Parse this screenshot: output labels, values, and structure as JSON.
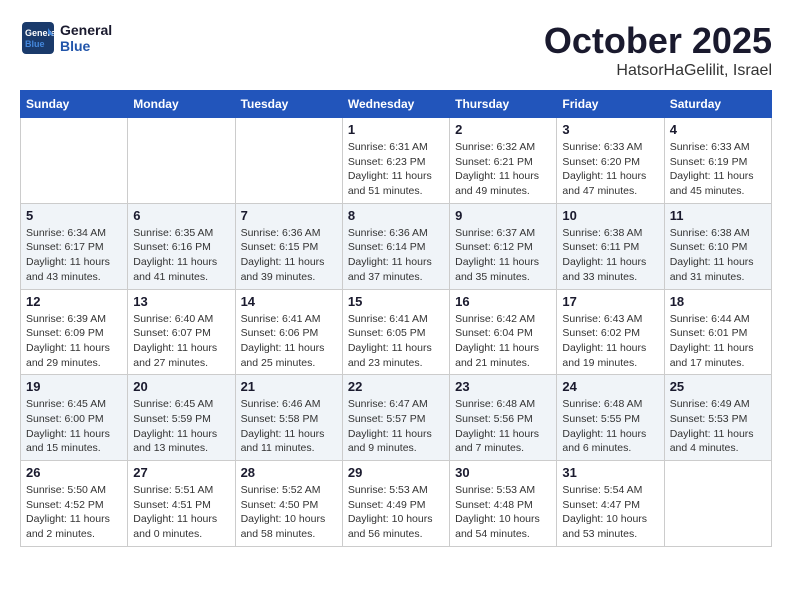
{
  "header": {
    "logo_line1": "General",
    "logo_line2": "Blue",
    "month": "October 2025",
    "location": "HatsorHaGelilit, Israel"
  },
  "days_of_week": [
    "Sunday",
    "Monday",
    "Tuesday",
    "Wednesday",
    "Thursday",
    "Friday",
    "Saturday"
  ],
  "weeks": [
    [
      {
        "day": "",
        "info": ""
      },
      {
        "day": "",
        "info": ""
      },
      {
        "day": "",
        "info": ""
      },
      {
        "day": "1",
        "info": "Sunrise: 6:31 AM\nSunset: 6:23 PM\nDaylight: 11 hours\nand 51 minutes."
      },
      {
        "day": "2",
        "info": "Sunrise: 6:32 AM\nSunset: 6:21 PM\nDaylight: 11 hours\nand 49 minutes."
      },
      {
        "day": "3",
        "info": "Sunrise: 6:33 AM\nSunset: 6:20 PM\nDaylight: 11 hours\nand 47 minutes."
      },
      {
        "day": "4",
        "info": "Sunrise: 6:33 AM\nSunset: 6:19 PM\nDaylight: 11 hours\nand 45 minutes."
      }
    ],
    [
      {
        "day": "5",
        "info": "Sunrise: 6:34 AM\nSunset: 6:17 PM\nDaylight: 11 hours\nand 43 minutes."
      },
      {
        "day": "6",
        "info": "Sunrise: 6:35 AM\nSunset: 6:16 PM\nDaylight: 11 hours\nand 41 minutes."
      },
      {
        "day": "7",
        "info": "Sunrise: 6:36 AM\nSunset: 6:15 PM\nDaylight: 11 hours\nand 39 minutes."
      },
      {
        "day": "8",
        "info": "Sunrise: 6:36 AM\nSunset: 6:14 PM\nDaylight: 11 hours\nand 37 minutes."
      },
      {
        "day": "9",
        "info": "Sunrise: 6:37 AM\nSunset: 6:12 PM\nDaylight: 11 hours\nand 35 minutes."
      },
      {
        "day": "10",
        "info": "Sunrise: 6:38 AM\nSunset: 6:11 PM\nDaylight: 11 hours\nand 33 minutes."
      },
      {
        "day": "11",
        "info": "Sunrise: 6:38 AM\nSunset: 6:10 PM\nDaylight: 11 hours\nand 31 minutes."
      }
    ],
    [
      {
        "day": "12",
        "info": "Sunrise: 6:39 AM\nSunset: 6:09 PM\nDaylight: 11 hours\nand 29 minutes."
      },
      {
        "day": "13",
        "info": "Sunrise: 6:40 AM\nSunset: 6:07 PM\nDaylight: 11 hours\nand 27 minutes."
      },
      {
        "day": "14",
        "info": "Sunrise: 6:41 AM\nSunset: 6:06 PM\nDaylight: 11 hours\nand 25 minutes."
      },
      {
        "day": "15",
        "info": "Sunrise: 6:41 AM\nSunset: 6:05 PM\nDaylight: 11 hours\nand 23 minutes."
      },
      {
        "day": "16",
        "info": "Sunrise: 6:42 AM\nSunset: 6:04 PM\nDaylight: 11 hours\nand 21 minutes."
      },
      {
        "day": "17",
        "info": "Sunrise: 6:43 AM\nSunset: 6:02 PM\nDaylight: 11 hours\nand 19 minutes."
      },
      {
        "day": "18",
        "info": "Sunrise: 6:44 AM\nSunset: 6:01 PM\nDaylight: 11 hours\nand 17 minutes."
      }
    ],
    [
      {
        "day": "19",
        "info": "Sunrise: 6:45 AM\nSunset: 6:00 PM\nDaylight: 11 hours\nand 15 minutes."
      },
      {
        "day": "20",
        "info": "Sunrise: 6:45 AM\nSunset: 5:59 PM\nDaylight: 11 hours\nand 13 minutes."
      },
      {
        "day": "21",
        "info": "Sunrise: 6:46 AM\nSunset: 5:58 PM\nDaylight: 11 hours\nand 11 minutes."
      },
      {
        "day": "22",
        "info": "Sunrise: 6:47 AM\nSunset: 5:57 PM\nDaylight: 11 hours\nand 9 minutes."
      },
      {
        "day": "23",
        "info": "Sunrise: 6:48 AM\nSunset: 5:56 PM\nDaylight: 11 hours\nand 7 minutes."
      },
      {
        "day": "24",
        "info": "Sunrise: 6:48 AM\nSunset: 5:55 PM\nDaylight: 11 hours\nand 6 minutes."
      },
      {
        "day": "25",
        "info": "Sunrise: 6:49 AM\nSunset: 5:53 PM\nDaylight: 11 hours\nand 4 minutes."
      }
    ],
    [
      {
        "day": "26",
        "info": "Sunrise: 5:50 AM\nSunset: 4:52 PM\nDaylight: 11 hours\nand 2 minutes."
      },
      {
        "day": "27",
        "info": "Sunrise: 5:51 AM\nSunset: 4:51 PM\nDaylight: 11 hours\nand 0 minutes."
      },
      {
        "day": "28",
        "info": "Sunrise: 5:52 AM\nSunset: 4:50 PM\nDaylight: 10 hours\nand 58 minutes."
      },
      {
        "day": "29",
        "info": "Sunrise: 5:53 AM\nSunset: 4:49 PM\nDaylight: 10 hours\nand 56 minutes."
      },
      {
        "day": "30",
        "info": "Sunrise: 5:53 AM\nSunset: 4:48 PM\nDaylight: 10 hours\nand 54 minutes."
      },
      {
        "day": "31",
        "info": "Sunrise: 5:54 AM\nSunset: 4:47 PM\nDaylight: 10 hours\nand 53 minutes."
      },
      {
        "day": "",
        "info": ""
      }
    ]
  ]
}
